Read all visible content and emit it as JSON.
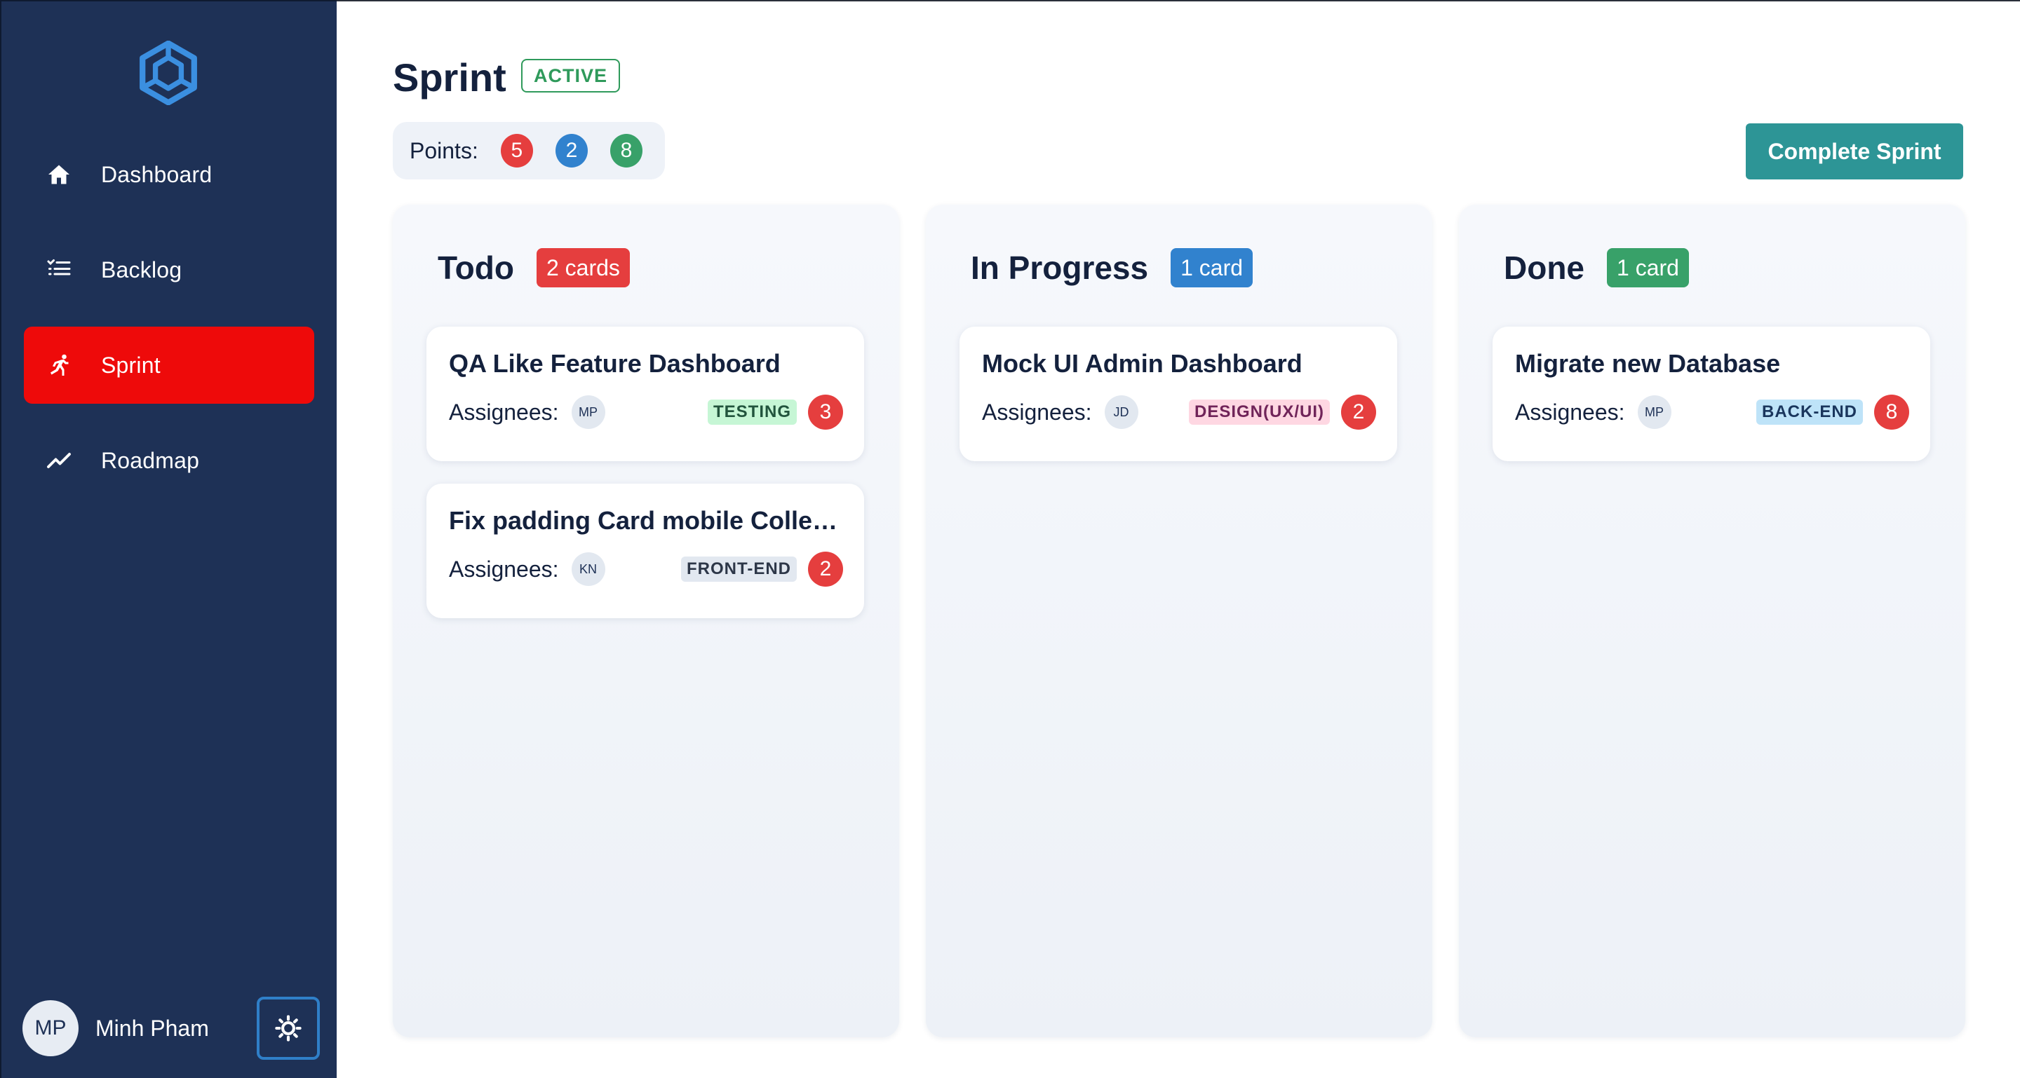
{
  "sidebar": {
    "logo_icon": "hexagon-cube-logo",
    "items": [
      {
        "label": "Dashboard",
        "icon": "home-icon",
        "active": false
      },
      {
        "label": "Backlog",
        "icon": "list-icon",
        "active": false
      },
      {
        "label": "Sprint",
        "icon": "running-icon",
        "active": true
      },
      {
        "label": "Roadmap",
        "icon": "trend-icon",
        "active": false
      }
    ],
    "user": {
      "initials": "MP",
      "name": "Minh Pham"
    },
    "theme_toggle_icon": "sun-icon"
  },
  "header": {
    "title": "Sprint",
    "status": "ACTIVE",
    "points_label": "Points:",
    "points": [
      {
        "value": "5",
        "color": "#e53e3e"
      },
      {
        "value": "2",
        "color": "#3182ce"
      },
      {
        "value": "8",
        "color": "#38a169"
      }
    ],
    "complete_button": "Complete Sprint"
  },
  "columns": [
    {
      "title": "Todo",
      "count": "2 cards",
      "count_color": "#e53e3e",
      "cards": [
        {
          "title": "QA Like Feature Dashboard",
          "assignees_label": "Assignees:",
          "assignee": "MP",
          "tag": "TESTING",
          "tag_bg": "#c6f6d5",
          "tag_fg": "#22543d",
          "points": "3"
        },
        {
          "title": "Fix padding Card mobile Collection",
          "assignees_label": "Assignees:",
          "assignee": "KN",
          "tag": "FRONT-END",
          "tag_bg": "#e2e8f0",
          "tag_fg": "#2d3748",
          "points": "2"
        }
      ]
    },
    {
      "title": "In Progress",
      "count": "1 card",
      "count_color": "#3182ce",
      "cards": [
        {
          "title": "Mock UI Admin Dashboard",
          "assignees_label": "Assignees:",
          "assignee": "JD",
          "tag": "DESIGN(UX/UI)",
          "tag_bg": "#fed7e2",
          "tag_fg": "#702459",
          "points": "2"
        }
      ]
    },
    {
      "title": "Done",
      "count": "1 card",
      "count_color": "#38a169",
      "cards": [
        {
          "title": "Migrate new Database",
          "assignees_label": "Assignees:",
          "assignee": "MP",
          "tag": "BACK-END",
          "tag_bg": "#bee3f8",
          "tag_fg": "#1a365d",
          "points": "8"
        }
      ]
    }
  ]
}
